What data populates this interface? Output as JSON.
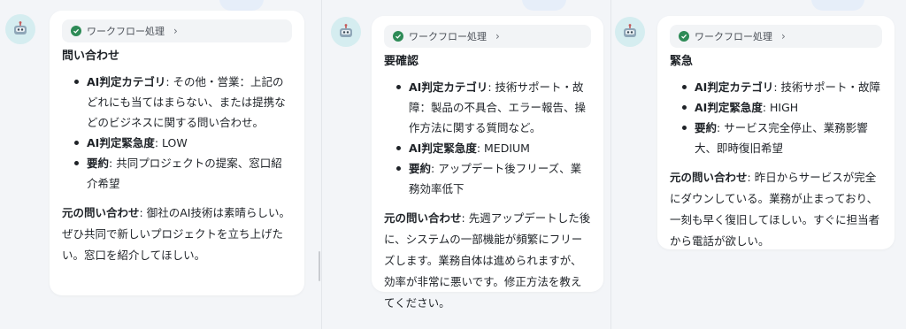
{
  "workflow_label": "ワークフロー処理",
  "cards": [
    {
      "title": "問い合わせ",
      "category_label": "AI判定カテゴリ",
      "category_value": ": その他・営業：上記のどれにも当てはまらない、または提携などのビジネスに関する問い合わせ。",
      "urgency_label": "AI判定緊急度",
      "urgency_value": ": LOW",
      "summary_label": "要約",
      "summary_value": ": 共同プロジェクトの提案、窓口紹介希望",
      "original_label": "元の問い合わせ",
      "original_value": ": 御社のAI技術は素晴らしい。ぜひ共同で新しいプロジェクトを立ち上げたい。窓口を紹介してほしい。"
    },
    {
      "title": "要確認",
      "category_label": "AI判定カテゴリ",
      "category_value": ": 技術サポート・故障：製品の不具合、エラー報告、操作方法に関する質問など。",
      "urgency_label": "AI判定緊急度",
      "urgency_value": ": MEDIUM",
      "summary_label": "要約",
      "summary_value": ": アップデート後フリーズ、業務効率低下",
      "original_label": "元の問い合わせ",
      "original_value": ": 先週アップデートした後に、システムの一部機能が頻繁にフリーズします。業務自体は進められますが、効率が非常に悪いです。修正方法を教えてください。"
    },
    {
      "title": "緊急",
      "category_label": "AI判定カテゴリ",
      "category_value": ": 技術サポート・故障",
      "urgency_label": "AI判定緊急度",
      "urgency_value": ": HIGH",
      "summary_label": "要約",
      "summary_value": ": サービス完全停止、業務影響大、即時復旧希望",
      "original_label": "元の問い合わせ",
      "original_value": ": 昨日からサービスが完全にダウンしている。業務が止まっており、一刻も早く復旧してほしい。すぐに担当者から電話が欲しい。"
    }
  ],
  "colors": {
    "background": "#f3f5f8",
    "card": "#ffffff",
    "check": "#2e8b57",
    "avatar": "#d5edf0"
  },
  "icons": [
    "bot-avatar-icon",
    "check-circle-icon",
    "chevron-right-icon"
  ]
}
